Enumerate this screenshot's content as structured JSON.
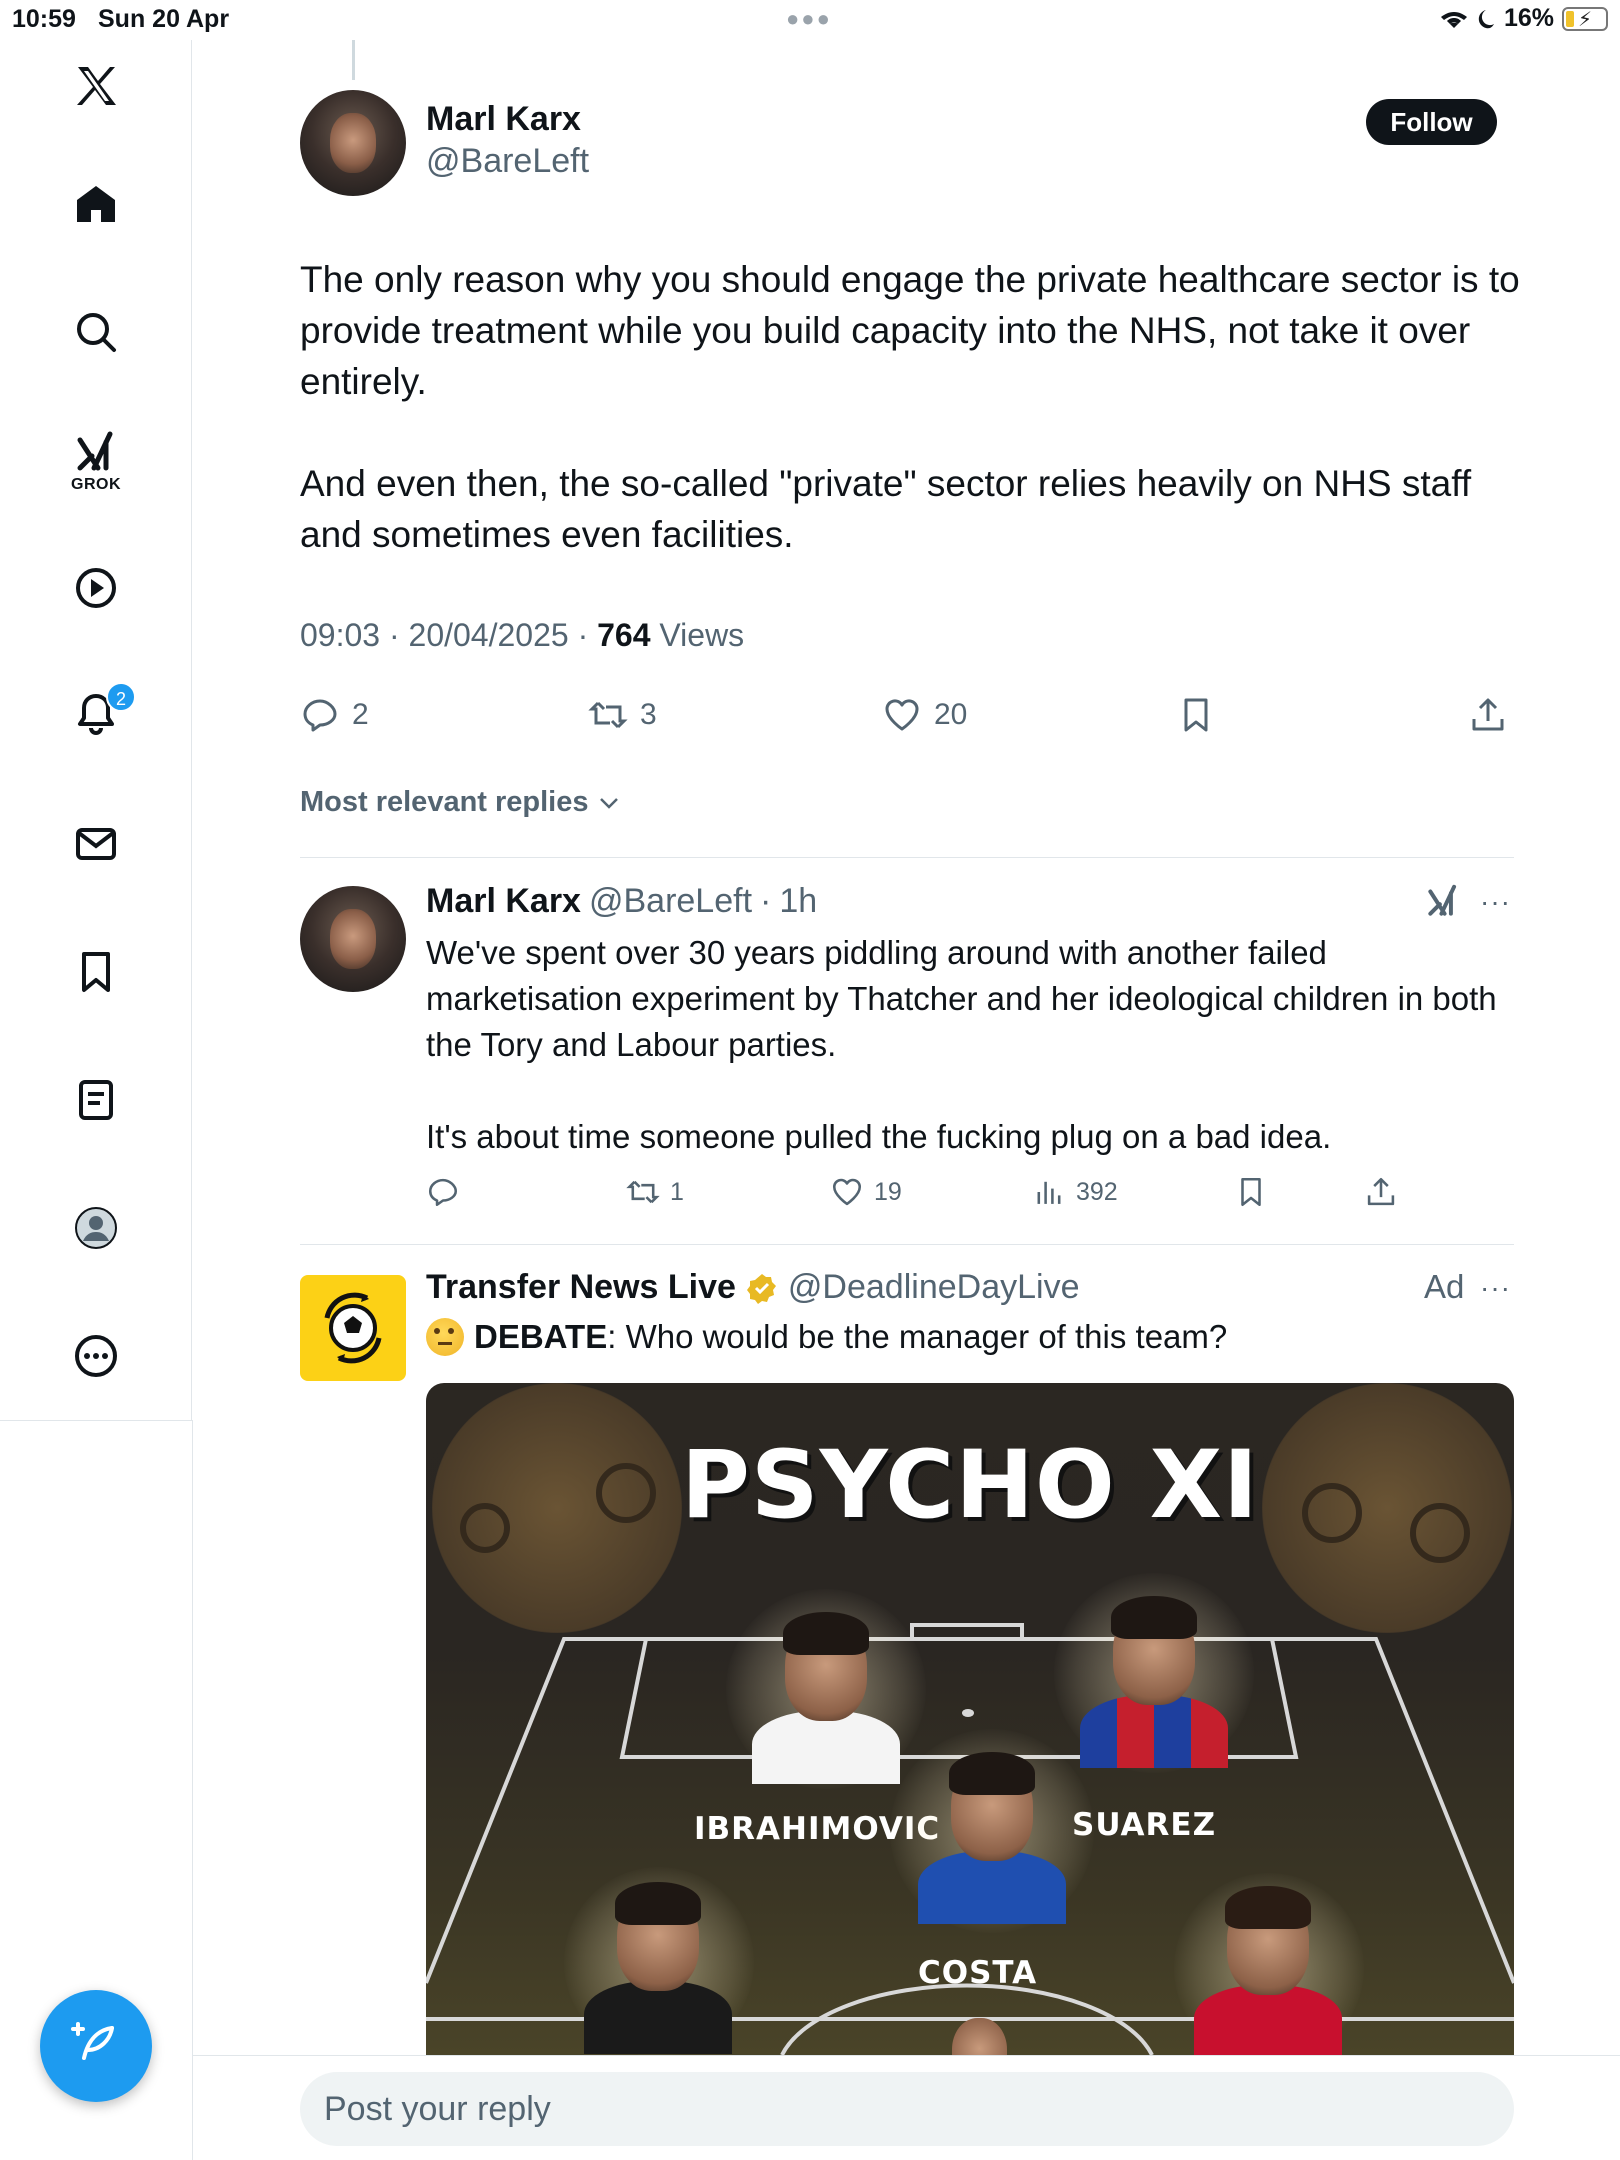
{
  "status_bar": {
    "time": "10:59",
    "date": "Sun 20 Apr",
    "battery": "16%"
  },
  "sidebar": {
    "grok_label": "GROK",
    "notifications_badge": "2"
  },
  "tweet": {
    "author_name": "Marl Karx",
    "author_handle": "@BareLeft",
    "follow_label": "Follow",
    "paragraph1": "The only reason why you should engage the private healthcare sector is to provide treatment while you build capacity into the NHS, not take it over entirely.",
    "paragraph2": "And even then, the so-called \"private\" sector relies heavily on NHS staff and sometimes even facilities.",
    "time": "09:03",
    "date": "20/04/2025",
    "views_count": "764",
    "views_label": "Views",
    "replies": "2",
    "reposts": "3",
    "likes": "20"
  },
  "replies_sort": "Most relevant replies",
  "reply": {
    "author_name": "Marl Karx",
    "author_handle": "@BareLeft",
    "time": "1h",
    "paragraph1": "We've spent over 30 years piddling around with another failed marketisation experiment by Thatcher and her ideological children in both the Tory and Labour parties.",
    "paragraph2": "It's about time someone pulled the fucking plug on a bad idea.",
    "reposts": "1",
    "likes": "19",
    "views": "392"
  },
  "ad": {
    "author_name": "Transfer News Live",
    "author_handle": "@DeadlineDayLive",
    "ad_label": "Ad",
    "debate_label": "DEBATE",
    "text": ": Who would be the manager of this team?",
    "image_title": "PSYCHO XI",
    "players": [
      "IBRAHIMOVIC",
      "SUAREZ",
      "COSTA"
    ]
  },
  "reply_input": {
    "placeholder": "Post your reply"
  },
  "colors": {
    "accent": "#1d9bf0",
    "text": "#0f1419",
    "secondary": "#536471",
    "ad_logo": "#fcd116"
  }
}
